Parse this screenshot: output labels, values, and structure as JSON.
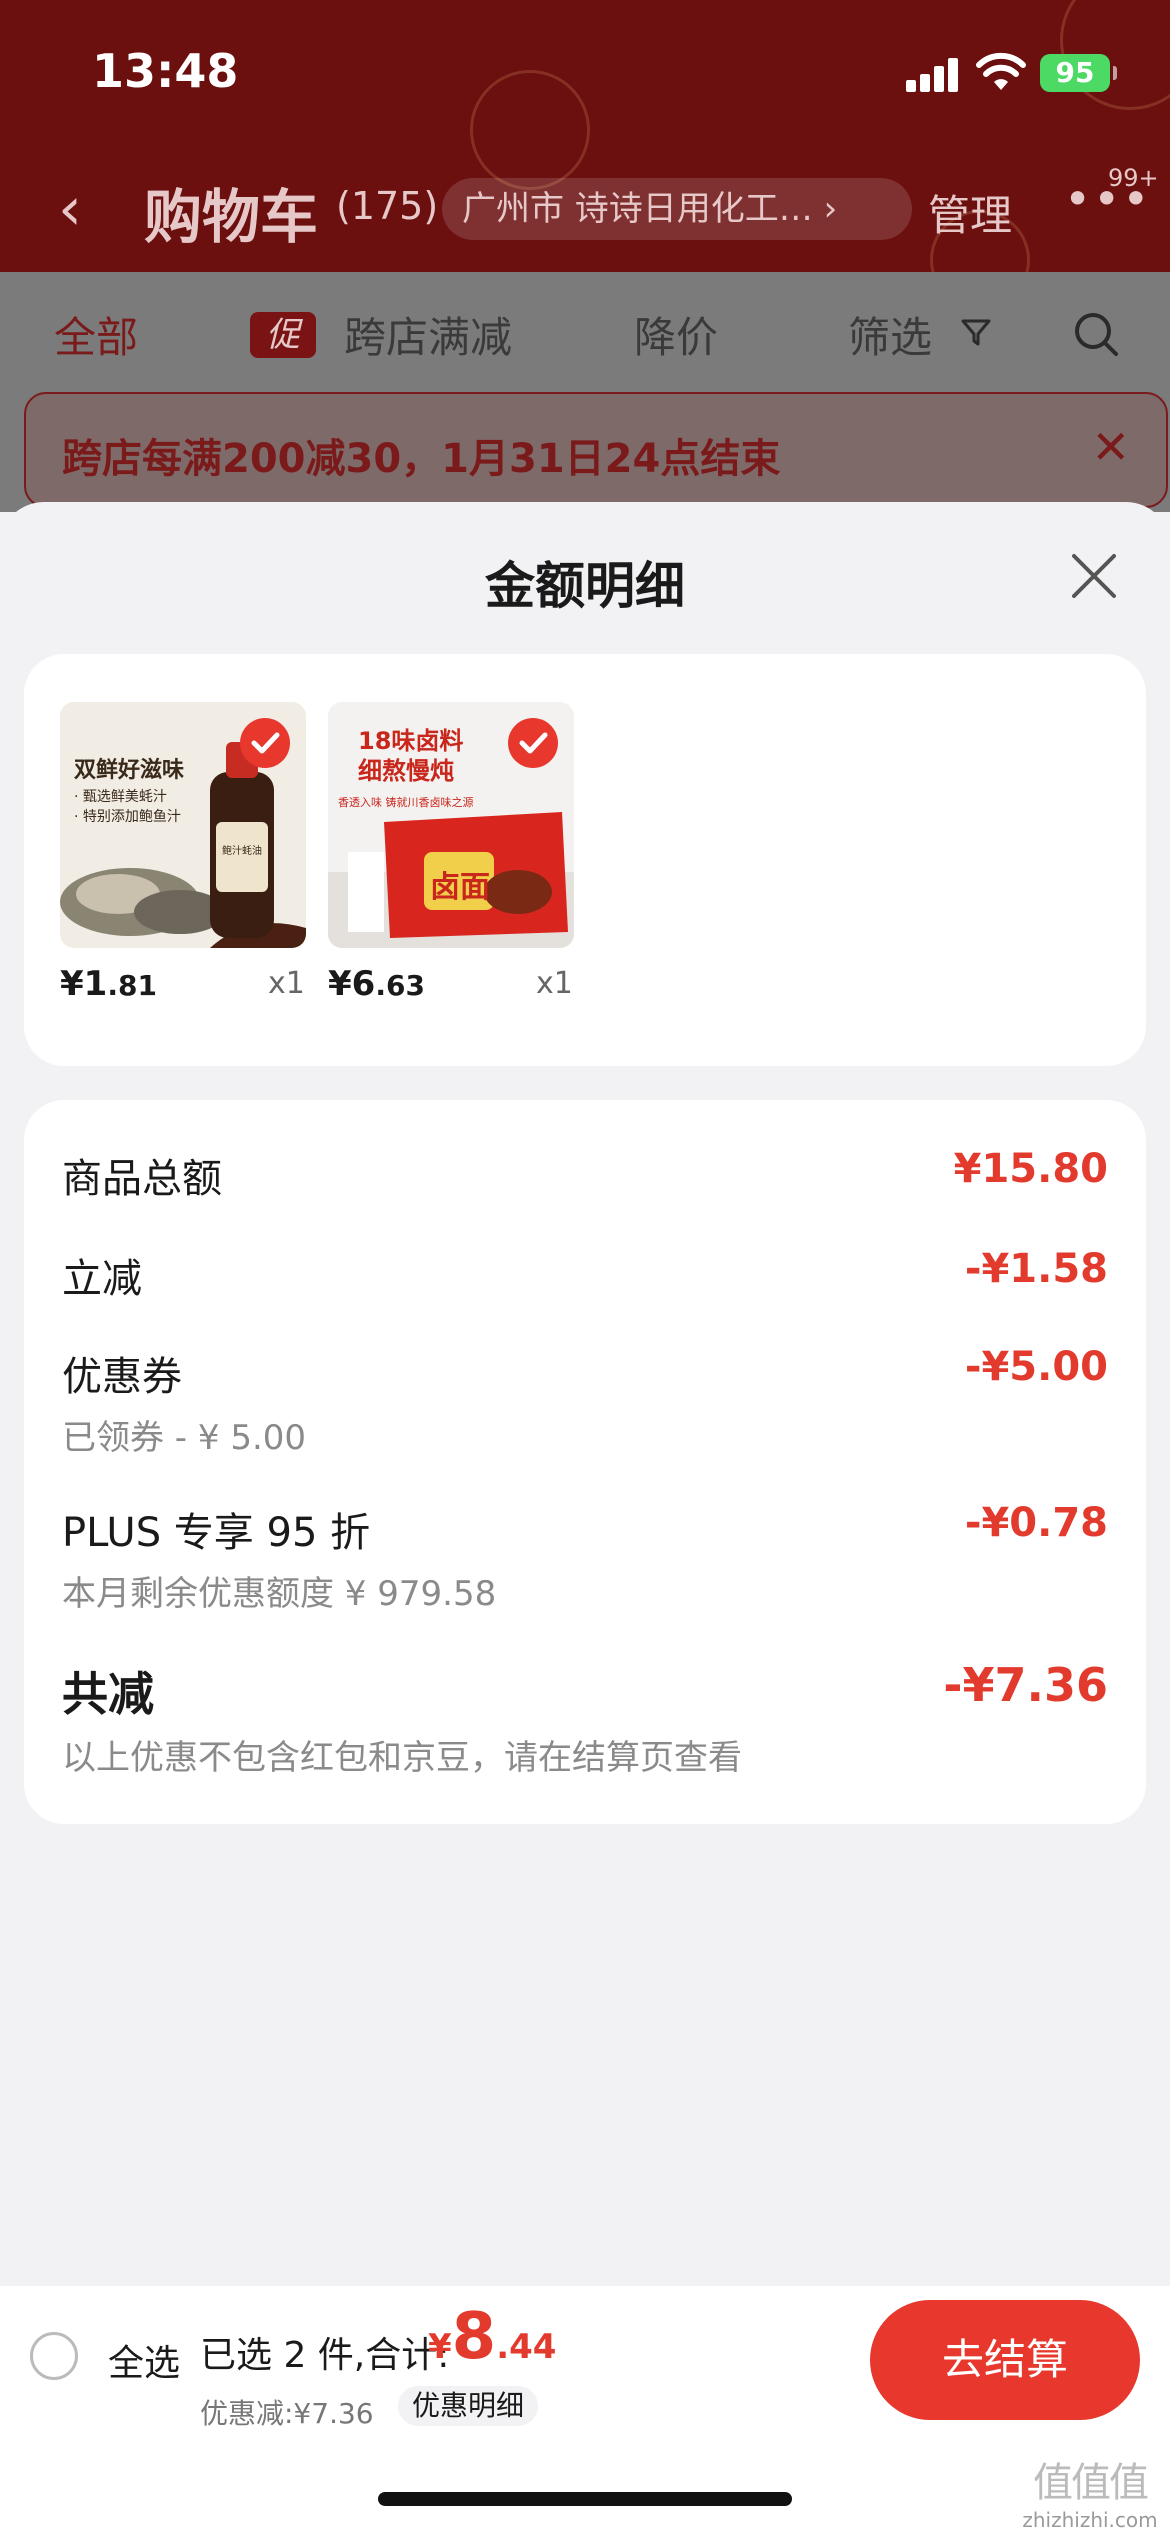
{
  "status_bar": {
    "time": "13:48",
    "battery": "95"
  },
  "header": {
    "back_icon": "chevron-left-icon",
    "title": "购物车",
    "count": "(175)",
    "address": "广州市  诗诗日用化工…  ›",
    "manage": "管理",
    "more_icon": "more-dots-icon",
    "more_badge": "99+"
  },
  "filters": {
    "all": "全部",
    "promo_tag": "促",
    "cross_store": "跨店满减",
    "price_drop": "降价",
    "filter": "筛选"
  },
  "banner": {
    "text": "跨店每满200减30，1月31日24点结束"
  },
  "sheet": {
    "title": "金额明细",
    "products": [
      {
        "name": "双鲜好滋味 鲍汁蚝油",
        "price_int": "¥1",
        "price_dec": ".81",
        "qty": "x1"
      },
      {
        "name": "18味卤料 细熬慢炖",
        "price_int": "¥6",
        "price_dec": ".63",
        "qty": "x1"
      }
    ],
    "product_images": {
      "p1_title": "双鲜好滋味",
      "p1_line1": "· 甄选鲜美蚝汁",
      "p1_line2": "· 特别添加鲍鱼汁",
      "p1_bottle": "鲍汁蚝油",
      "p2_title1": "18味卤料",
      "p2_title2": "细熬慢炖",
      "p2_line": "香透入味 铸就川香卤味之源",
      "p2_pack": "卤面"
    },
    "summary": {
      "goods_total_label": "商品总额",
      "goods_total_value": "¥15.80",
      "instant_label": "立减",
      "instant_value": "-¥1.58",
      "coupon_label": "优惠券",
      "coupon_value": "-¥5.00",
      "coupon_sub": "已领券 - ¥ 5.00",
      "plus_label": "PLUS 专享 95 折",
      "plus_value": "-¥0.78",
      "plus_sub": "本月剩余优惠额度  ¥ 979.58",
      "total_label": "共减",
      "total_value": "-¥7.36",
      "total_sub": "以上优惠不包含红包和京豆，请在结算页查看"
    }
  },
  "bottom_bar": {
    "select_all": "全选",
    "selected_text": "已选 2 件,合计:",
    "price_yen": "¥",
    "price_int": "8",
    "price_dec": ".44",
    "discount_text": "优惠减:¥7.36",
    "detail_button": "优惠明细",
    "checkout_button": "去结算"
  },
  "watermark": {
    "logo": "值值值",
    "site": "zhizhizhi.com"
  },
  "colors": {
    "accent": "#e8382e",
    "price": "#e23b2e",
    "header_bg": "#6b0f0f"
  }
}
